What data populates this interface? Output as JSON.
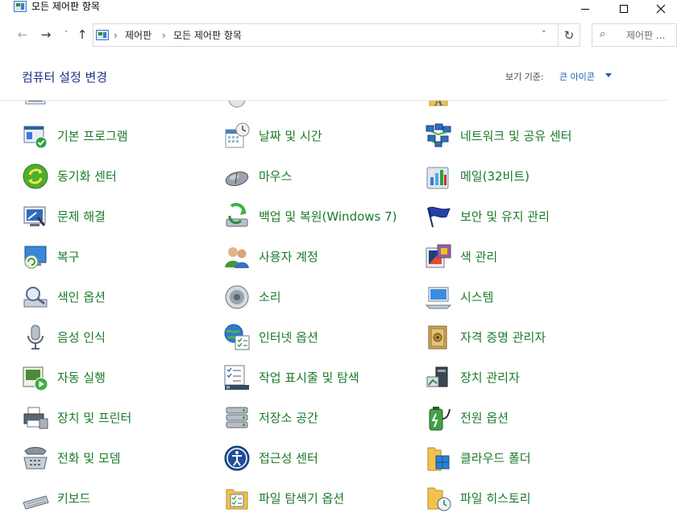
{
  "window": {
    "title": "모든 제어판 항목"
  },
  "address": {
    "crumbs": [
      "제어판",
      "모든 제어판 항목"
    ],
    "search_placeholder": "제어판 ..."
  },
  "header": {
    "title": "컴퓨터 설정 변경",
    "view_by_label": "보기 기준:",
    "view_by_value": "큰 아이콘"
  },
  "items": [
    {
      "label": "기본 프로그램",
      "icon": "default-programs-icon"
    },
    {
      "label": "날짜 및 시간",
      "icon": "calendar-clock-icon"
    },
    {
      "label": "네트워크 및 공유 센터",
      "icon": "network-icon"
    },
    {
      "label": "동기화 센터",
      "icon": "sync-icon"
    },
    {
      "label": "마우스",
      "icon": "mouse-icon"
    },
    {
      "label": "메일(32비트)",
      "icon": "mail-icon"
    },
    {
      "label": "문제 해결",
      "icon": "troubleshoot-icon"
    },
    {
      "label": "백업 및 복원(Windows 7)",
      "icon": "backup-icon"
    },
    {
      "label": "보안 및 유지 관리",
      "icon": "flag-icon"
    },
    {
      "label": "복구",
      "icon": "recovery-icon"
    },
    {
      "label": "사용자 계정",
      "icon": "users-icon"
    },
    {
      "label": "색 관리",
      "icon": "color-management-icon"
    },
    {
      "label": "색인 옵션",
      "icon": "indexing-icon"
    },
    {
      "label": "소리",
      "icon": "speaker-icon"
    },
    {
      "label": "시스템",
      "icon": "system-icon"
    },
    {
      "label": "음성 인식",
      "icon": "microphone-icon"
    },
    {
      "label": "인터넷 옵션",
      "icon": "internet-options-icon"
    },
    {
      "label": "자격 증명 관리자",
      "icon": "credential-vault-icon"
    },
    {
      "label": "자동 실행",
      "icon": "autoplay-icon"
    },
    {
      "label": "작업 표시줄 및 탐색",
      "icon": "taskbar-icon"
    },
    {
      "label": "장치 관리자",
      "icon": "device-manager-icon"
    },
    {
      "label": "장치 및 프린터",
      "icon": "printer-icon"
    },
    {
      "label": "저장소 공간",
      "icon": "storage-spaces-icon"
    },
    {
      "label": "전원 옵션",
      "icon": "battery-icon"
    },
    {
      "label": "전화 및 모뎀",
      "icon": "phone-modem-icon"
    },
    {
      "label": "접근성 센터",
      "icon": "ease-of-access-icon"
    },
    {
      "label": "클라우드 폴더",
      "icon": "cloud-folder-icon"
    },
    {
      "label": "키보드",
      "icon": "keyboard-icon"
    },
    {
      "label": "파일 탐색기 옵션",
      "icon": "folder-options-icon"
    },
    {
      "label": "파일 히스토리",
      "icon": "file-history-icon"
    }
  ]
}
